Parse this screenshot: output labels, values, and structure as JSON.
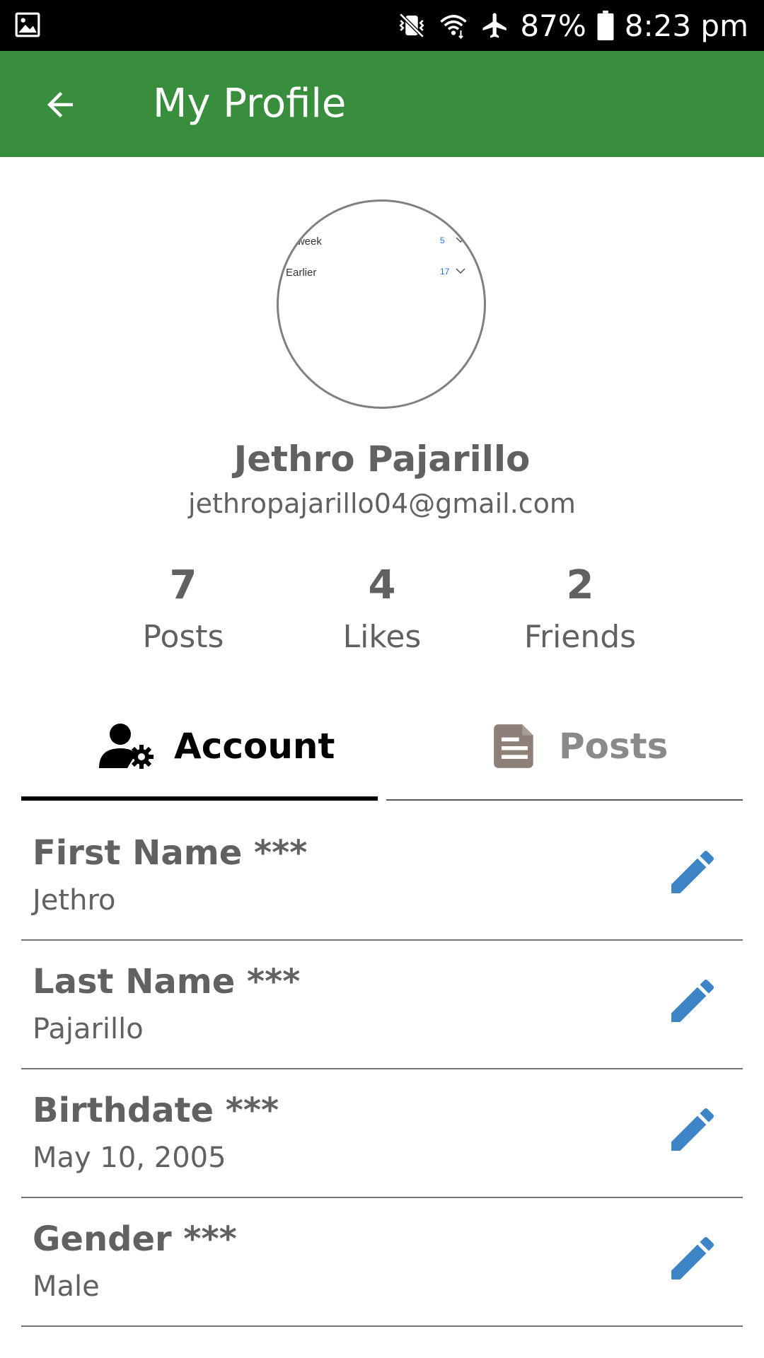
{
  "status_bar": {
    "battery": "87%",
    "time": "8:23 pm",
    "icons": [
      "image-icon",
      "vibrate-mute-icon",
      "wifi-icon",
      "airplane-icon",
      "battery-icon"
    ]
  },
  "app_bar": {
    "title": "My Profile",
    "back_icon": "arrow-left-icon",
    "background": "#388e3c"
  },
  "avatar": {
    "rows": [
      {
        "label": "st week",
        "count": "5"
      },
      {
        "label": "Earlier",
        "count": "17"
      }
    ]
  },
  "profile": {
    "name": "Jethro Pajarillo",
    "email": "jethropajarillo04@gmail.com"
  },
  "stats": [
    {
      "value": "7",
      "label": "Posts"
    },
    {
      "value": "4",
      "label": "Likes"
    },
    {
      "value": "2",
      "label": "Friends"
    }
  ],
  "tabs": [
    {
      "label": "Account",
      "icon": "user-gear-icon",
      "active": true
    },
    {
      "label": "Posts",
      "icon": "document-icon",
      "active": false
    }
  ],
  "fields": [
    {
      "label": "First Name ***",
      "value": "Jethro"
    },
    {
      "label": "Last Name ***",
      "value": "Pajarillo"
    },
    {
      "label": "Birthdate ***",
      "value": "May 10, 2005"
    },
    {
      "label": "Gender ***",
      "value": "Male"
    }
  ],
  "colors": {
    "accent": "#388e3c",
    "text_gray": "#616161",
    "edit_blue": "#3d85c6",
    "posts_icon": "#8d8079"
  }
}
